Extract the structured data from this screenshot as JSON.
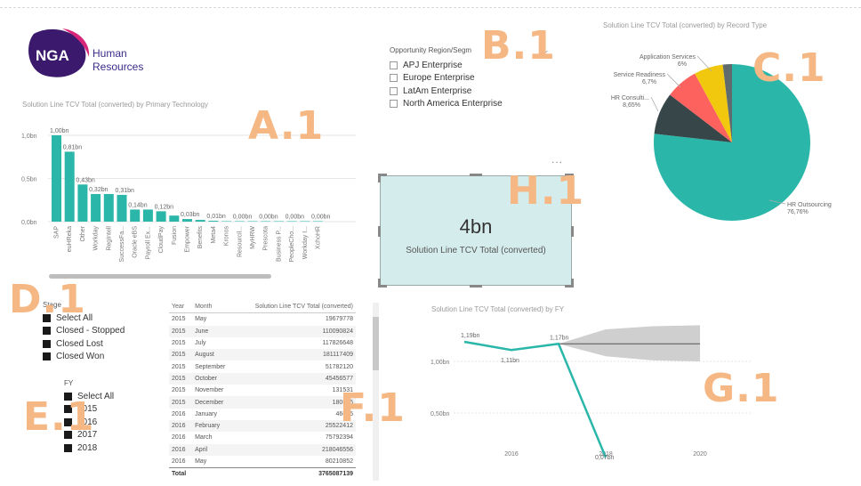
{
  "logo": {
    "badge": "NGA",
    "line1": "Human",
    "line2": "Resources"
  },
  "region_slicer": {
    "title": "Opportunity Region/Segm",
    "items": [
      "APJ Enterprise",
      "Europe Enterprise",
      "LatAm Enterprise",
      "North America Enterprise"
    ]
  },
  "stage_slicer": {
    "title": "Stage",
    "items": [
      "Select All",
      "Closed - Stopped",
      "Closed Lost",
      "Closed Won"
    ]
  },
  "fy_slicer": {
    "title": "FY",
    "items": [
      "Select All",
      "2015",
      "2016",
      "2017",
      "2018"
    ]
  },
  "card": {
    "value": "4bn",
    "label": "Solution Line TCV Total (converted)",
    "more": "..."
  },
  "table": {
    "headers": [
      "Year",
      "Month",
      "Solution Line TCV Total (converted)"
    ],
    "rows": [
      [
        "2015",
        "May",
        "19679778"
      ],
      [
        "2015",
        "June",
        "110090824"
      ],
      [
        "2015",
        "July",
        "117826648"
      ],
      [
        "2015",
        "August",
        "181117409"
      ],
      [
        "2015",
        "September",
        "51782120"
      ],
      [
        "2015",
        "October",
        "45456577"
      ],
      [
        "2015",
        "November",
        "131531"
      ],
      [
        "2015",
        "December",
        "180605"
      ],
      [
        "2016",
        "January",
        "46005"
      ],
      [
        "2016",
        "February",
        "25522412"
      ],
      [
        "2016",
        "March",
        "75792394"
      ],
      [
        "2016",
        "April",
        "218046556"
      ],
      [
        "2016",
        "May",
        "80210852"
      ]
    ],
    "total_label": "Total",
    "total_value": "3765087139"
  },
  "callouts": {
    "A": "A.1",
    "B": "B.1",
    "C": "C.1",
    "D": "D.1",
    "E": "E.1",
    "F": "F.1",
    "G": "G.1",
    "H": "H.1"
  },
  "colors": {
    "teal": "#2ab7a9",
    "dark": "#374649",
    "red": "#fd625e",
    "yellow": "#f2c80f",
    "gray": "#5f6b6d",
    "callout": "#f5b783"
  },
  "chart_data": [
    {
      "type": "bar",
      "title": "Solution Line TCV Total (converted) by Primary Technology",
      "categories": [
        "SAP",
        "euHReka",
        "Other",
        "Workday",
        "RegIntell",
        "SuccessFa...",
        "Oracle eBS",
        "Payroll Ex...",
        "CloudPay",
        "Fusion",
        "Empower",
        "Benefits",
        "Meta4",
        "Kronos",
        "Resourcil...",
        "MyHRW",
        "Prescota",
        "Business P...",
        "PeopleCho...",
        "Workday I...",
        "XchoHR"
      ],
      "values": [
        1.0,
        0.81,
        0.43,
        0.32,
        0.32,
        0.31,
        0.14,
        0.14,
        0.12,
        0.07,
        0.03,
        0.02,
        0.01,
        0.003,
        0.002,
        0.001,
        0.001,
        0.001,
        0.001,
        0.0005,
        0.0003
      ],
      "labels": [
        "1,00bn",
        "0,81bn",
        "0,43bn",
        "0,32bn",
        "",
        "0,31bn",
        "0,14bn",
        "",
        "0,12bn",
        "",
        "0,03bn",
        "",
        "0,01bn",
        "",
        "0,00bn",
        "",
        "0,00bn",
        "",
        "0,00bn",
        "",
        "0,00bn"
      ],
      "yticks": [
        "1,0bn",
        "0,5bn",
        "0,0bn"
      ],
      "ylim": [
        0,
        1.0
      ]
    },
    {
      "type": "pie",
      "title": "Solution Line TCV Total (converted) by Record Type",
      "slices": [
        {
          "name": "HR Outsourcing",
          "label": "76,76%",
          "value": 76.76
        },
        {
          "name": "HR Consulti...",
          "label": "8,65%",
          "value": 8.65
        },
        {
          "name": "Service Readiness",
          "label": "6,7%",
          "value": 6.7
        },
        {
          "name": "Application Services",
          "label": "6%",
          "value": 6.0
        },
        {
          "name": "",
          "label": "",
          "value": 1.89
        }
      ]
    },
    {
      "type": "line",
      "title": "Solution Line TCV Total (converted) by FY",
      "x": [
        2015,
        2016,
        2017,
        2018
      ],
      "values": [
        1.19,
        1.11,
        1.17,
        0.07
      ],
      "point_labels": [
        "1,19bn",
        "1,11bn",
        "1,17bn",
        "0,07bn"
      ],
      "yticks": [
        "1,00bn",
        "0,50bn"
      ],
      "xticks": [
        "2016",
        "2018",
        "2020"
      ],
      "forecast": {
        "x": [
          2017,
          2018,
          2019,
          2020
        ],
        "mid": [
          1.17,
          1.17,
          1.17,
          1.17
        ],
        "upper": [
          1.17,
          1.31,
          1.34,
          1.35
        ],
        "lower": [
          1.17,
          1.05,
          1.01,
          1.0
        ]
      }
    }
  ]
}
